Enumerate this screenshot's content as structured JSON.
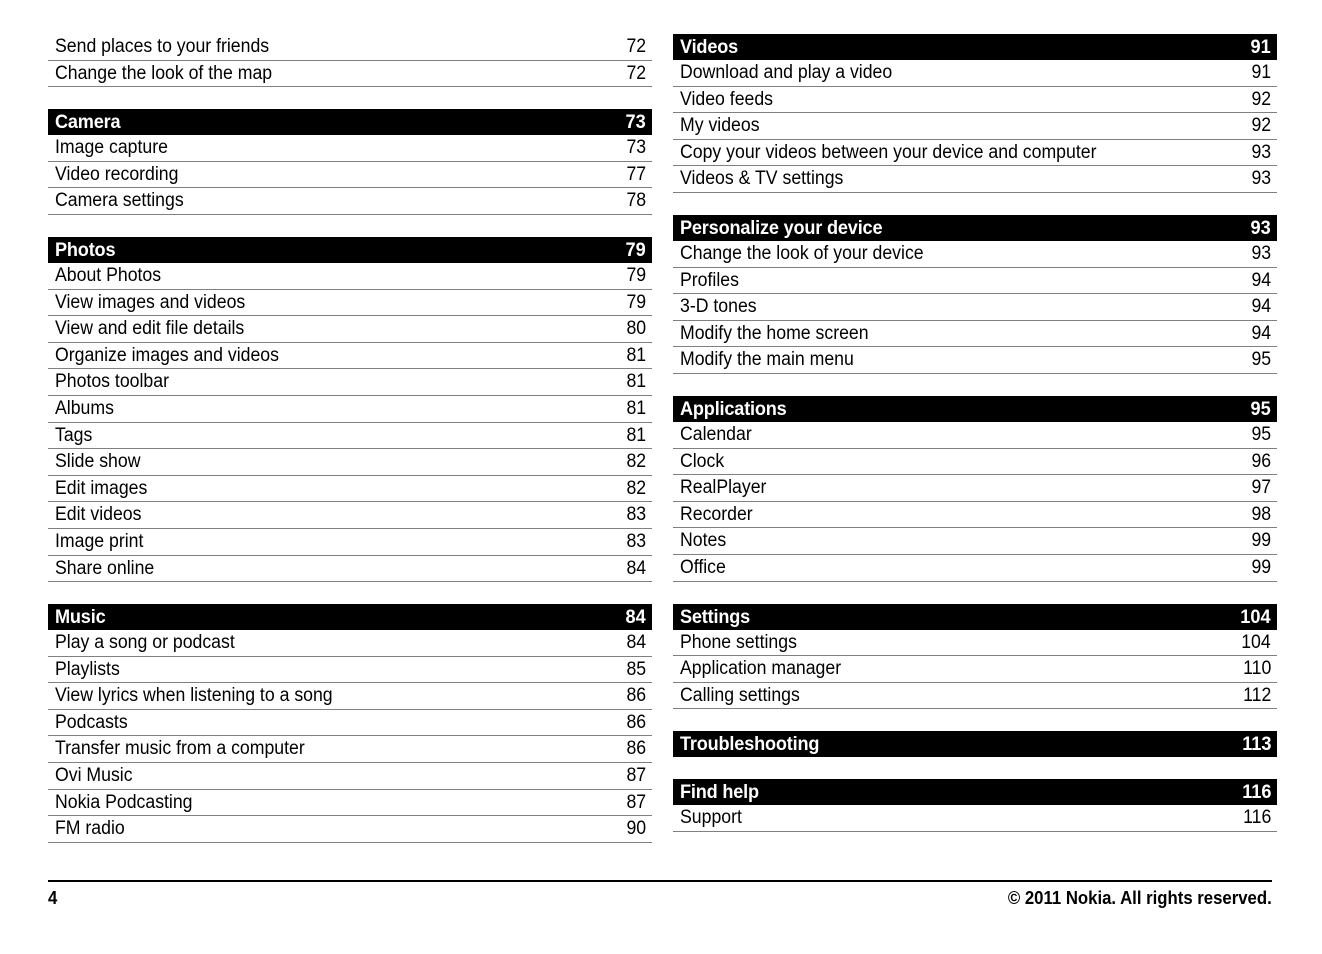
{
  "document": {
    "page_number": "4",
    "copyright": "© 2011 Nokia. All rights reserved."
  },
  "left_column": {
    "continued_entries": [
      {
        "title": "Send places to your friends",
        "page": "72"
      },
      {
        "title": "Change the look of the map",
        "page": "72"
      }
    ],
    "sections": [
      {
        "title": "Camera",
        "page": "73",
        "entries": [
          {
            "title": "Image capture",
            "page": "73"
          },
          {
            "title": "Video recording",
            "page": "77"
          },
          {
            "title": "Camera settings",
            "page": "78"
          }
        ]
      },
      {
        "title": "Photos",
        "page": "79",
        "entries": [
          {
            "title": "About Photos",
            "page": "79"
          },
          {
            "title": "View images and videos",
            "page": "79"
          },
          {
            "title": "View and edit file details",
            "page": "80"
          },
          {
            "title": "Organize images and videos",
            "page": "81"
          },
          {
            "title": "Photos toolbar",
            "page": "81"
          },
          {
            "title": "Albums",
            "page": "81"
          },
          {
            "title": "Tags",
            "page": "81"
          },
          {
            "title": "Slide show",
            "page": "82"
          },
          {
            "title": "Edit images",
            "page": "82"
          },
          {
            "title": "Edit videos",
            "page": "83"
          },
          {
            "title": "Image print",
            "page": "83"
          },
          {
            "title": "Share online",
            "page": "84"
          }
        ]
      },
      {
        "title": "Music",
        "page": "84",
        "entries": [
          {
            "title": "Play a song or podcast",
            "page": "84"
          },
          {
            "title": "Playlists",
            "page": "85"
          },
          {
            "title": "View lyrics when listening to a song",
            "page": "86"
          },
          {
            "title": "Podcasts",
            "page": "86"
          },
          {
            "title": "Transfer music from a computer",
            "page": "86"
          },
          {
            "title": "Ovi Music",
            "page": "87"
          },
          {
            "title": "Nokia Podcasting",
            "page": "87"
          },
          {
            "title": "FM radio",
            "page": "90"
          }
        ]
      }
    ]
  },
  "right_column": {
    "sections": [
      {
        "title": "Videos",
        "page": "91",
        "entries": [
          {
            "title": "Download and play a video",
            "page": "91"
          },
          {
            "title": "Video feeds",
            "page": "92"
          },
          {
            "title": "My videos",
            "page": "92"
          },
          {
            "title": "Copy your videos between your device and computer",
            "page": "93"
          },
          {
            "title": "Videos & TV settings",
            "page": "93"
          }
        ]
      },
      {
        "title": "Personalize your device",
        "page": "93",
        "entries": [
          {
            "title": "Change the look of your device",
            "page": "93"
          },
          {
            "title": "Profiles",
            "page": "94"
          },
          {
            "title": "3-D tones",
            "page": "94"
          },
          {
            "title": "Modify the home screen",
            "page": "94"
          },
          {
            "title": "Modify the main menu",
            "page": "95"
          }
        ]
      },
      {
        "title": "Applications",
        "page": "95",
        "entries": [
          {
            "title": "Calendar",
            "page": "95"
          },
          {
            "title": "Clock",
            "page": "96"
          },
          {
            "title": "RealPlayer",
            "page": "97"
          },
          {
            "title": "Recorder",
            "page": "98"
          },
          {
            "title": "Notes",
            "page": "99"
          },
          {
            "title": "Office",
            "page": "99"
          }
        ]
      },
      {
        "title": "Settings",
        "page": "104",
        "entries": [
          {
            "title": "Phone settings",
            "page": "104"
          },
          {
            "title": "Application manager",
            "page": "110"
          },
          {
            "title": "Calling settings",
            "page": "112"
          }
        ]
      },
      {
        "title": "Troubleshooting",
        "page": "113",
        "entries": []
      },
      {
        "title": "Find help",
        "page": "116",
        "entries": [
          {
            "title": "Support",
            "page": "116"
          }
        ]
      }
    ]
  }
}
